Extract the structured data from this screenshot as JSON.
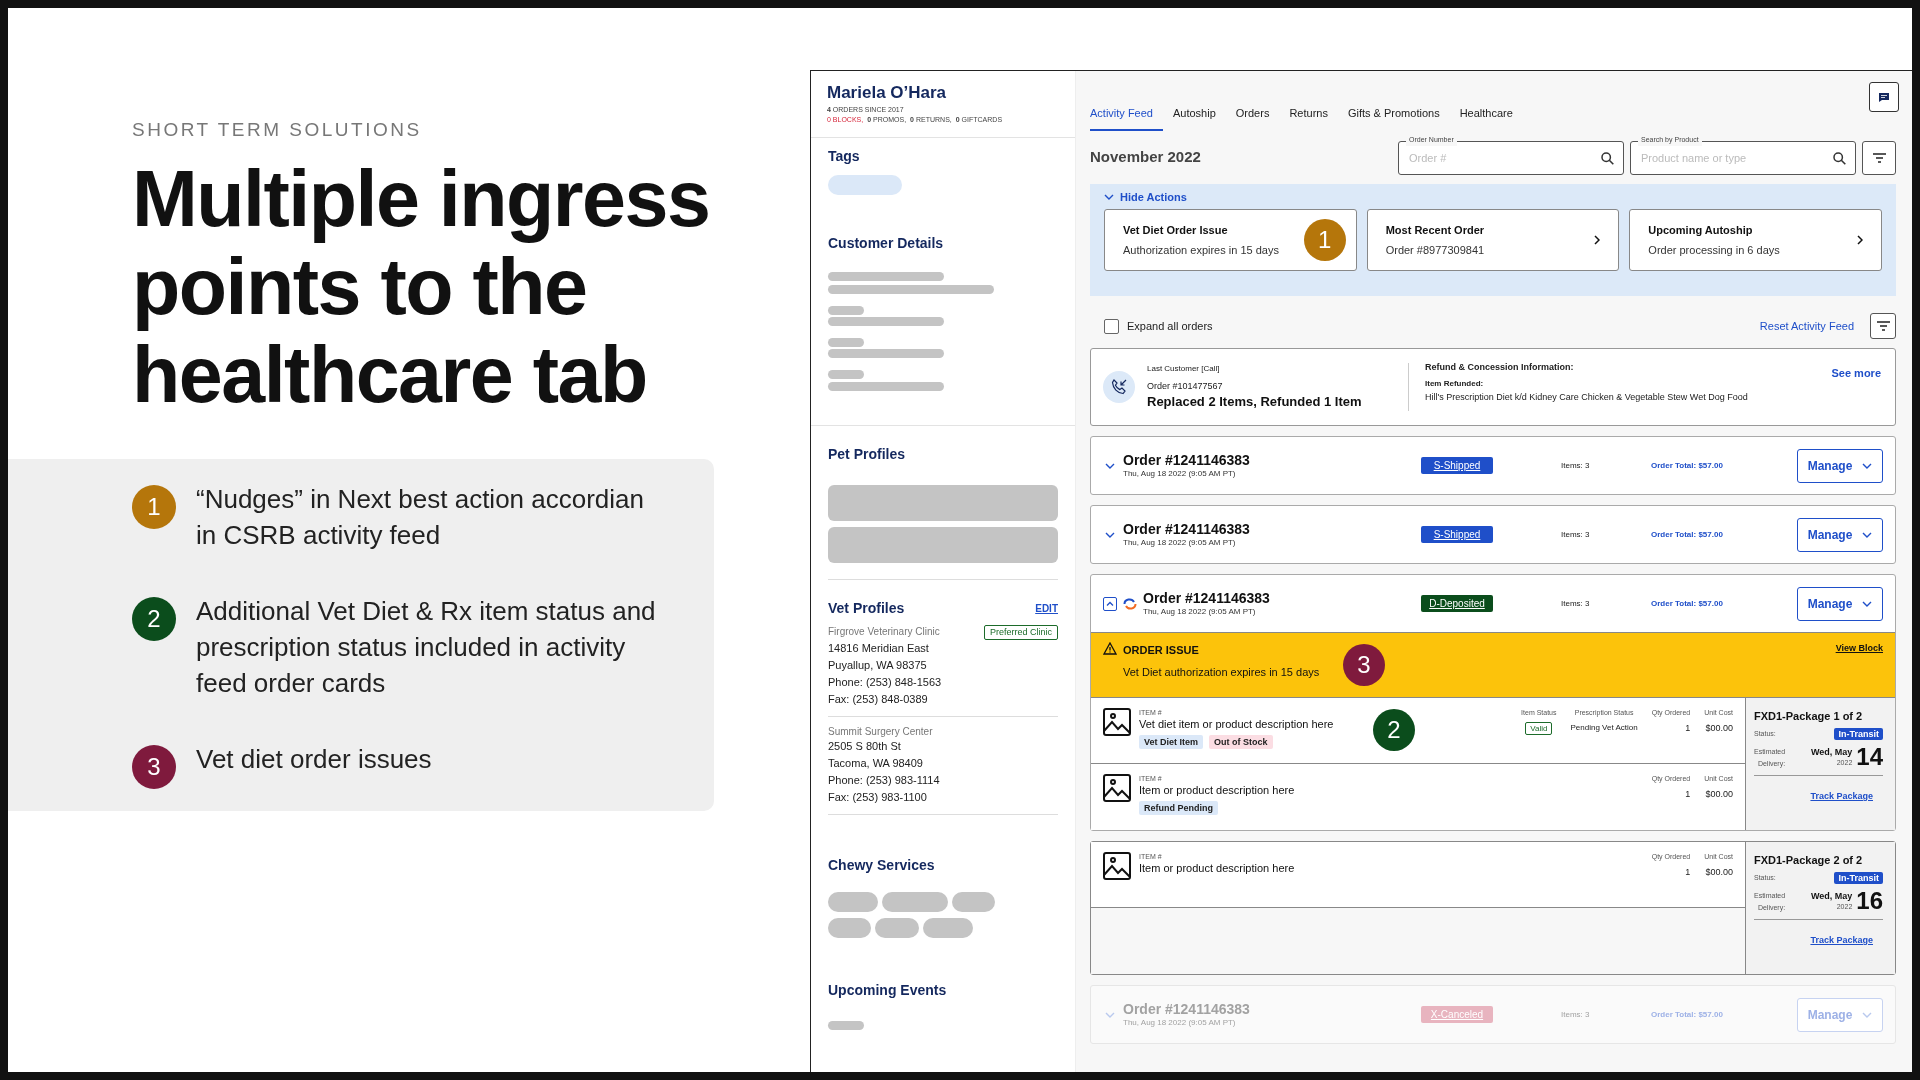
{
  "slide": {
    "eyebrow": "SHORT TERM SOLUTIONS",
    "title": "Multiple ingress points to the healthcare tab",
    "points": [
      {
        "number": "1",
        "color": "#b5760b",
        "text": "“Nudges” in Next best action accordian in CSRB activity feed"
      },
      {
        "number": "2",
        "color": "#0b4d1c",
        "text": "Additional Vet Diet & Rx item status and prescription status included in activity feed order cards"
      },
      {
        "number": "3",
        "color": "#7f1a3d",
        "text": "Vet diet order issues"
      }
    ]
  },
  "customer": {
    "name": "Mariela O’Hara",
    "since": "**4** ORDERS SINCE 2017",
    "counts": [
      {
        "text": "0 BLOCKS,",
        "alert": true
      },
      {
        "text": "**0** PROMOS,",
        "alert": false
      },
      {
        "text": "**0** RETURNS,",
        "alert": false
      },
      {
        "text": "**0** GIFTCARDS",
        "alert": false
      }
    ]
  },
  "sidebar": [
    {
      "kind": "tags",
      "title": "Tags"
    },
    {
      "kind": "lines",
      "title": "Customer Details"
    },
    {
      "kind": "blocks",
      "title": "Pet Profiles"
    },
    {
      "kind": "vets",
      "title": "Vet Profiles",
      "action": "EDIT",
      "clinics": [
        {
          "name": "Firgrove Veterinary Clinic",
          "badge": "Preferred Clinic",
          "lines": [
            "14816 Meridian East",
            "Puyallup, WA 98375",
            "Phone: (253) 848-1563",
            "Fax: (253) 848-0389"
          ]
        },
        {
          "name": "Summit Surgery Center",
          "lines": [
            "2505 S 80th St",
            "Tacoma, WA 98409",
            "Phone: (253) 983-1114",
            "Fax: (253) 983-1100"
          ]
        }
      ]
    },
    {
      "kind": "pills",
      "title": "Chewy Services"
    },
    {
      "kind": "events",
      "title": "Upcoming Events"
    }
  ],
  "tabs": [
    {
      "label": "Activity Feed",
      "selected": true
    },
    {
      "label": "Autoship",
      "selected": false
    },
    {
      "label": "Orders",
      "selected": false
    },
    {
      "label": "Returns",
      "selected": false
    },
    {
      "label": "Gifts & Promotions",
      "selected": false
    },
    {
      "label": "Healthcare",
      "selected": false
    }
  ],
  "month": "November 2022",
  "searches": [
    {
      "label": "Order Number",
      "placeholder": "Order #"
    },
    {
      "label": "Search by Product",
      "placeholder": "Product name or type"
    }
  ],
  "actions": {
    "toggle": "Hide Actions",
    "expanded": true,
    "cards": [
      {
        "title": "Vet Diet Order Issue",
        "subtitle": "Authorization expires in 15 days",
        "arrow": false,
        "callout": {
          "number": "1",
          "color": "#b5760b"
        }
      },
      {
        "title": "Most Recent Order",
        "subtitle": "Order #8977309841",
        "arrow": true
      },
      {
        "title": "Upcoming Autoship",
        "subtitle": "Order processing in 6 days",
        "arrow": true
      }
    ]
  },
  "expand_all": {
    "label": "Expand all orders",
    "checked": false
  },
  "reset": "Reset Activity Feed",
  "last_contact": {
    "label": "Last Customer [Call]",
    "order": "Order #101477567",
    "summary": "Replaced 2 Items, Refunded 1 Item",
    "refund_title": "Refund & Concession Information:",
    "item_label": "Item Refunded:",
    "item": "Hill's Prescription Diet k/d Kidney Care Chicken & Vegetable Stew Wet Dog Food",
    "link": "See more"
  },
  "orders": [
    {
      "number": "Order #1241146383",
      "date": "Thu, Aug 18 2022 (9:05 AM PT)",
      "status": "S-Shipped",
      "color": "#1f4fc9",
      "items": "Items: 3",
      "total": "Order Total: $57.00",
      "manage": "Manage",
      "expanded": false,
      "disabled": false,
      "autoship": false
    },
    {
      "number": "Order #1241146383",
      "date": "Thu, Aug 18 2022 (9:05 AM PT)",
      "status": "S-Shipped",
      "color": "#1f4fc9",
      "items": "Items: 3",
      "total": "Order Total: $57.00",
      "manage": "Manage",
      "expanded": false,
      "disabled": false,
      "autoship": false
    },
    {
      "number": "Order #1241146383",
      "date": "Thu, Aug 18 2022 (9:05 AM PT)",
      "status": "D-Deposited",
      "color": "#0b4d1c",
      "items": "Items: 3",
      "total": "Order Total: $57.00",
      "manage": "Manage",
      "expanded": true,
      "disabled": false,
      "autoship": true,
      "issue": {
        "title": "ORDER ISSUE",
        "text": "Vet Diet authorization expires in 15 days",
        "link": "View Block",
        "callout": {
          "number": "3",
          "color": "#7f1a3d"
        }
      },
      "shipments": [
        {
          "items": [
            {
              "label": "ITEM #",
              "description": "Vet diet item or product description here",
              "tags": [
                {
                  "text": "Vet Diet Item",
                  "color": "#dbe8f8"
                },
                {
                  "text": "Out of Stock",
                  "color": "#fbdde3"
                }
              ],
              "callout": {
                "number": "2",
                "color": "#0b4d1c"
              },
              "columns": [
                {
                  "label": "Item Status",
                  "value": "Valid",
                  "kind": "badge"
                },
                {
                  "label": "Prescription Status",
                  "value": "Pending Vet Action",
                  "kind": "text"
                },
                {
                  "label": "Qty Ordered",
                  "value": "1",
                  "kind": "number"
                },
                {
                  "label": "Unit Cost",
                  "value": "$00.00",
                  "kind": "number"
                }
              ]
            },
            {
              "label": "ITEM #",
              "description": "Item or product description here",
              "tags": [
                {
                  "text": "Refund Pending",
                  "color": "#dbe8f8"
                }
              ],
              "columns": [
                {
                  "label": "Qty Ordered",
                  "value": "1",
                  "kind": "number"
                },
                {
                  "label": "Unit Cost",
                  "value": "$00.00",
                  "kind": "number"
                }
              ]
            }
          ],
          "package": {
            "title": "FXD1-Package 1 of 2",
            "status_label": "Status:",
            "status": "In-Transit",
            "est_label": "Estimated",
            "delivery_label": "Delivery:",
            "date": "Wed, May",
            "year": "2022",
            "day": "14",
            "link": "Track Package"
          }
        },
        {
          "items": [
            {
              "label": "ITEM #",
              "description": "Item or product description here",
              "columns": [
                {
                  "label": "Qty Ordered",
                  "value": "1",
                  "kind": "number"
                },
                {
                  "label": "Unit Cost",
                  "value": "$00.00",
                  "kind": "number"
                }
              ]
            }
          ],
          "package": {
            "title": "FXD1-Package 2 of 2",
            "status_label": "Status:",
            "status": "In-Transit",
            "est_label": "Estimated",
            "delivery_label": "Delivery:",
            "date": "Wed, May",
            "year": "2022",
            "day": "16",
            "link": "Track Package"
          }
        }
      ]
    },
    {
      "number": "Order #1241146383",
      "date": "Thu, Aug 18 2022 (9:05 AM PT)",
      "status": "X-Canceled",
      "color": "#e8b4bf",
      "items": "Items: 3",
      "total": "Order Total: $57.00",
      "manage": "Manage",
      "expanded": false,
      "disabled": true,
      "autoship": false
    }
  ]
}
